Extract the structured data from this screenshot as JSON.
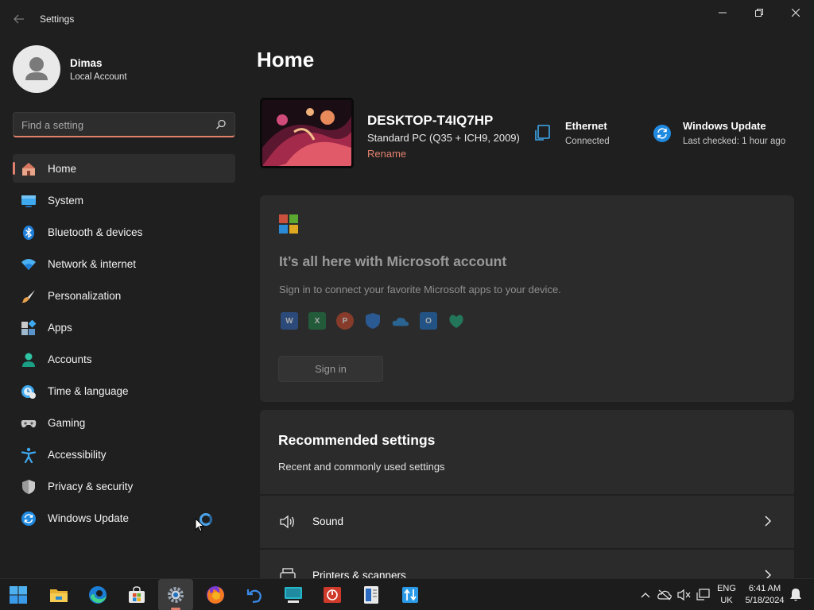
{
  "window": {
    "title": "Settings",
    "accent": "#e0816e"
  },
  "profile": {
    "name": "Dimas",
    "account_type": "Local Account"
  },
  "search": {
    "placeholder": "Find a setting"
  },
  "sidebar": {
    "items": [
      {
        "label": "Home",
        "icon": "home-icon",
        "active": true
      },
      {
        "label": "System",
        "icon": "system-icon"
      },
      {
        "label": "Bluetooth & devices",
        "icon": "bluetooth-icon"
      },
      {
        "label": "Network & internet",
        "icon": "wifi-icon"
      },
      {
        "label": "Personalization",
        "icon": "brush-icon"
      },
      {
        "label": "Apps",
        "icon": "apps-icon"
      },
      {
        "label": "Accounts",
        "icon": "person-icon"
      },
      {
        "label": "Time & language",
        "icon": "clock-globe-icon"
      },
      {
        "label": "Gaming",
        "icon": "gamepad-icon"
      },
      {
        "label": "Accessibility",
        "icon": "accessibility-icon"
      },
      {
        "label": "Privacy & security",
        "icon": "shield-icon"
      },
      {
        "label": "Windows Update",
        "icon": "update-icon"
      }
    ]
  },
  "main": {
    "title": "Home",
    "device": {
      "name": "DESKTOP-T4IQ7HP",
      "model": "Standard PC (Q35 + ICH9, 2009)",
      "rename_label": "Rename"
    },
    "status": {
      "network": {
        "title": "Ethernet",
        "subtitle": "Connected"
      },
      "update": {
        "title": "Windows Update",
        "subtitle": "Last checked: 1 hour ago"
      }
    },
    "ms_account": {
      "title": "It’s all here with Microsoft account",
      "subtitle": "Sign in to connect your favorite Microsoft apps to your device.",
      "apps": [
        "word-icon",
        "excel-icon",
        "powerpoint-icon",
        "defender-icon",
        "onedrive-icon",
        "outlook-icon",
        "family-icon"
      ],
      "signin_label": "Sign in"
    },
    "recommended": {
      "title": "Recommended settings",
      "subtitle": "Recent and commonly used settings",
      "items": [
        {
          "label": "Sound",
          "icon": "speaker-icon"
        },
        {
          "label": "Printers & scanners",
          "icon": "printer-icon"
        }
      ]
    }
  },
  "taskbar": {
    "apps": [
      "start-icon",
      "file-explorer-icon",
      "edge-icon",
      "store-icon",
      "settings-icon",
      "firefox-icon",
      "undo-app-icon",
      "remote-desktop-icon",
      "power-app-icon",
      "notepad-app-icon",
      "transfer-app-icon"
    ],
    "language": {
      "line1": "ENG",
      "line2": "UK"
    },
    "clock": {
      "time": "6:41 AM",
      "date": "5/18/2024"
    }
  }
}
